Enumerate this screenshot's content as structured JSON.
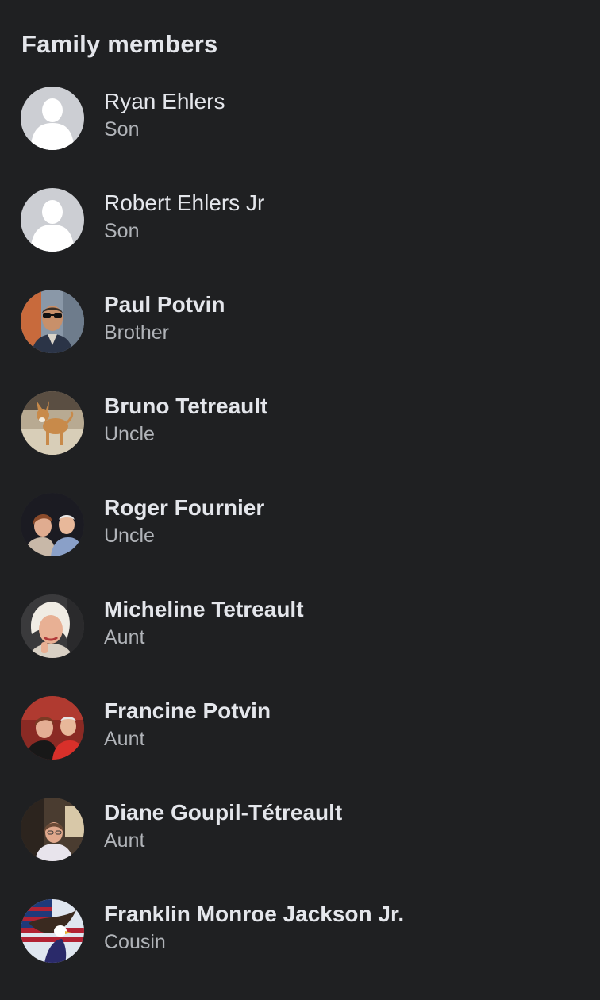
{
  "section": {
    "title": "Family members"
  },
  "members": [
    {
      "name": "Ryan Ehlers",
      "relation": "Son",
      "avatar_icon": "default-profile-silhouette-icon"
    },
    {
      "name": "Robert Ehlers Jr",
      "relation": "Son",
      "avatar_icon": "default-profile-silhouette-icon"
    },
    {
      "name": "Paul Potvin",
      "relation": "Brother",
      "avatar_icon": "profile-photo-man-sunglasses"
    },
    {
      "name": "Bruno Tetreault",
      "relation": "Uncle",
      "avatar_icon": "profile-photo-dog"
    },
    {
      "name": "Roger Fournier",
      "relation": "Uncle",
      "avatar_icon": "profile-photo-couple"
    },
    {
      "name": "Micheline Tetreault",
      "relation": "Aunt",
      "avatar_icon": "profile-photo-woman"
    },
    {
      "name": "Francine Potvin",
      "relation": "Aunt",
      "avatar_icon": "profile-photo-couple-red"
    },
    {
      "name": "Diane Goupil-Tétreault",
      "relation": "Aunt",
      "avatar_icon": "profile-photo-woman-indoor"
    },
    {
      "name": "Franklin Monroe Jackson Jr.",
      "relation": "Cousin",
      "avatar_icon": "profile-photo-eagle-flag"
    }
  ],
  "colors": {
    "background": "#1f2022",
    "primary_text": "#e4e6eb",
    "secondary_text": "#b0b3b8",
    "default_avatar_bg": "#ccced3"
  }
}
